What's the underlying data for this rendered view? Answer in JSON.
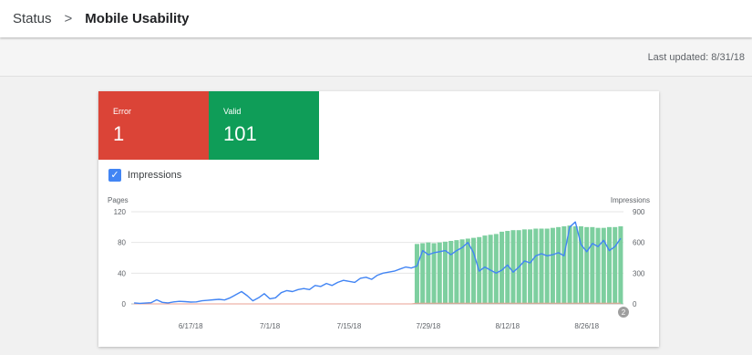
{
  "breadcrumb": {
    "root": "Status",
    "separator": ">",
    "current": "Mobile Usability"
  },
  "last_updated": "Last updated: 8/31/18",
  "tiles": [
    {
      "label": "Error",
      "value": "1",
      "color": "#db4437"
    },
    {
      "label": "Valid",
      "value": "101",
      "color": "#0f9d58"
    }
  ],
  "impressions_toggle": {
    "label": "Impressions",
    "checked": true
  },
  "annotation_marker": "2",
  "chart_data": {
    "type": "bar",
    "left_axis_title": "Pages",
    "right_axis_title": "Impressions",
    "left_ticks": [
      "120",
      "80",
      "40",
      "0"
    ],
    "right_ticks": [
      "900",
      "600",
      "300",
      "0"
    ],
    "ylim_left": [
      0,
      120
    ],
    "ylim_right": [
      0,
      900
    ],
    "x_ticks": [
      {
        "day": 10,
        "label": "6/17/18"
      },
      {
        "day": 24,
        "label": "7/1/18"
      },
      {
        "day": 38,
        "label": "7/15/18"
      },
      {
        "day": 52,
        "label": "7/29/18"
      },
      {
        "day": 66,
        "label": "8/12/18"
      },
      {
        "day": 80,
        "label": "8/26/18"
      }
    ],
    "start_date": "6/7/18",
    "end_date": "8/30/18",
    "series": [
      {
        "name": "Valid",
        "kind": "bar",
        "color": "#0f9d58",
        "axis": "left",
        "values": [
          0,
          0,
          0,
          0,
          0,
          0,
          0,
          0,
          0,
          0,
          0,
          0,
          0,
          0,
          0,
          0,
          0,
          0,
          0,
          0,
          0,
          0,
          0,
          0,
          0,
          0,
          0,
          0,
          0,
          0,
          0,
          0,
          0,
          0,
          0,
          0,
          0,
          0,
          0,
          0,
          0,
          0,
          0,
          0,
          0,
          0,
          0,
          0,
          0,
          0,
          78,
          79,
          80,
          79,
          80,
          81,
          82,
          83,
          84,
          85,
          86,
          87,
          89,
          90,
          91,
          94,
          95,
          96,
          96,
          97,
          97,
          98,
          98,
          98,
          99,
          100,
          101,
          102,
          101,
          101,
          100,
          100,
          99,
          99,
          100,
          100,
          101
        ]
      },
      {
        "name": "Error",
        "kind": "line",
        "color": "#db4437",
        "axis": "left",
        "values": [
          0,
          0,
          0,
          0,
          0,
          0,
          0,
          0,
          0,
          0,
          0,
          0,
          0,
          0,
          0,
          0,
          0,
          0,
          0,
          0,
          0,
          0,
          0,
          0,
          0,
          0,
          0,
          0,
          0,
          0,
          0,
          0,
          0,
          0,
          0,
          0,
          0,
          0,
          0,
          0,
          0,
          0,
          0,
          0,
          0,
          0,
          0,
          0,
          0,
          0,
          1,
          1,
          1,
          1,
          1,
          1,
          1,
          1,
          1,
          1,
          1,
          1,
          1,
          1,
          1,
          1,
          1,
          1,
          1,
          1,
          1,
          1,
          1,
          1,
          1,
          1,
          1,
          1,
          1,
          1,
          1,
          1,
          1,
          1,
          1,
          1,
          1
        ]
      },
      {
        "name": "Impressions",
        "kind": "line",
        "color": "#4285f4",
        "axis": "right",
        "values": [
          10,
          5,
          8,
          12,
          40,
          15,
          10,
          20,
          25,
          22,
          18,
          20,
          30,
          35,
          40,
          45,
          38,
          60,
          90,
          120,
          80,
          30,
          60,
          100,
          50,
          60,
          110,
          130,
          120,
          140,
          150,
          140,
          180,
          170,
          200,
          180,
          210,
          230,
          220,
          210,
          250,
          260,
          240,
          280,
          300,
          310,
          320,
          340,
          360,
          350,
          370,
          520,
          480,
          500,
          510,
          520,
          480,
          520,
          550,
          600,
          500,
          320,
          360,
          330,
          300,
          330,
          380,
          310,
          360,
          420,
          400,
          470,
          490,
          470,
          480,
          500,
          470,
          750,
          800,
          580,
          510,
          590,
          560,
          620,
          520,
          560,
          640
        ]
      }
    ]
  }
}
